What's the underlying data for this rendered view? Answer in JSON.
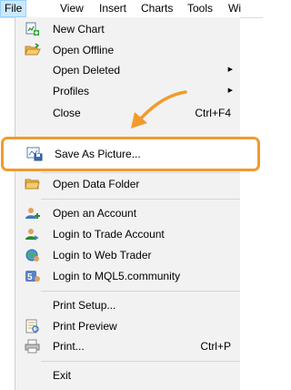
{
  "menubar": {
    "file": "File",
    "view": "View",
    "insert": "Insert",
    "charts": "Charts",
    "tools": "Tools",
    "window_partial": "Wi"
  },
  "file_menu": {
    "new_chart": "New Chart",
    "open_offline": "Open Offline",
    "open_deleted": "Open Deleted",
    "profiles": "Profiles",
    "close": "Close",
    "close_shortcut": "Ctrl+F4",
    "save_as_picture": "Save As Picture...",
    "open_data_folder": "Open Data Folder",
    "open_account": "Open an Account",
    "login_trade": "Login to Trade Account",
    "login_web": "Login to Web Trader",
    "login_mql5": "Login to MQL5.community",
    "print_setup": "Print Setup...",
    "print_preview": "Print Preview",
    "print": "Print...",
    "print_shortcut": "Ctrl+P",
    "exit": "Exit"
  },
  "colors": {
    "highlight_border": "#f29a2e",
    "menu_background": "#f2f2f2",
    "active_menubar": "#cce8ff"
  }
}
